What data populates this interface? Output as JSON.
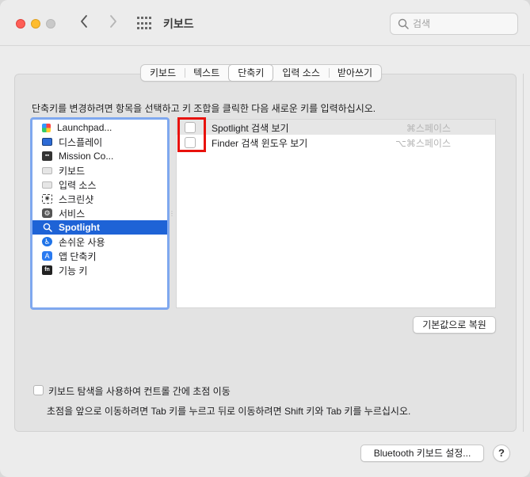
{
  "window": {
    "title": "키보드",
    "search_placeholder": "검색"
  },
  "tabs": [
    {
      "label": "키보드",
      "active": false
    },
    {
      "label": "텍스트",
      "active": false
    },
    {
      "label": "단축키",
      "active": true
    },
    {
      "label": "입력 소스",
      "active": false
    },
    {
      "label": "받아쓰기",
      "active": false
    }
  ],
  "instruction": "단축키를 변경하려면 항목을 선택하고 키 조합을 클릭한 다음 새로운 키를 입력하십시오.",
  "categories": [
    {
      "label": "Launchpad...",
      "icon": "launchpad-icon"
    },
    {
      "label": "디스플레이",
      "icon": "display-icon"
    },
    {
      "label": "Mission Co...",
      "icon": "mission-control-icon"
    },
    {
      "label": "키보드",
      "icon": "keyboard-icon"
    },
    {
      "label": "입력 소스",
      "icon": "input-source-icon"
    },
    {
      "label": "스크린샷",
      "icon": "screenshot-icon"
    },
    {
      "label": "서비스",
      "icon": "services-icon"
    },
    {
      "label": "Spotlight",
      "icon": "spotlight-icon",
      "selected": true
    },
    {
      "label": "손쉬운 사용",
      "icon": "accessibility-icon"
    },
    {
      "label": "앱 단축키",
      "icon": "app-shortcuts-icon"
    },
    {
      "label": "기능 키",
      "icon": "function-keys-icon"
    }
  ],
  "shortcuts": [
    {
      "label": "Spotlight 검색 보기",
      "keys": "⌘스페이스",
      "checked": false
    },
    {
      "label": "Finder 검색 윈도우 보기",
      "keys": "⌥⌘스페이스",
      "checked": false
    }
  ],
  "restore_button": "기본값으로 복원",
  "keyboard_navigation": {
    "label": "키보드 탐색을 사용하여 컨트롤 간에 초점 이동",
    "description": "초점을 앞으로 이동하려면 Tab 키를 누르고 뒤로 이동하려면 Shift 키와 Tab 키를 누르십시오.",
    "checked": false
  },
  "bluetooth_button": "Bluetooth 키보드 설정...",
  "help_button": "?",
  "colors": {
    "selection": "#1e63d6",
    "focus_ring": "#7fa8ef",
    "annotation_red": "#e8120c",
    "close": "#fe5f57",
    "minimize": "#febc2e"
  }
}
